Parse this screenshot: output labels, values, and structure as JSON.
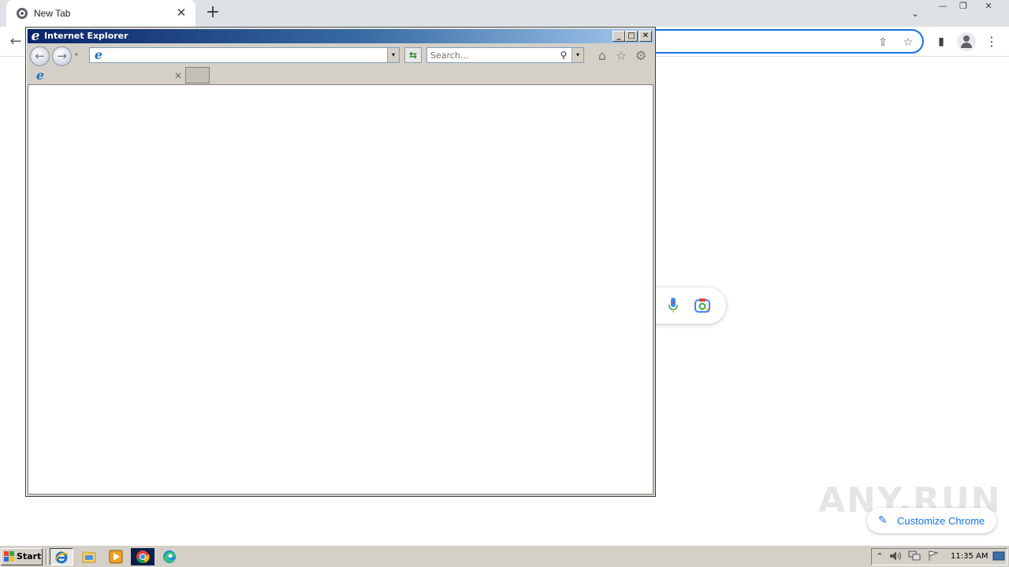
{
  "chrome": {
    "tab_title": "New Tab",
    "tab_close": "✕",
    "new_tab": "+",
    "tab_search": "⌄",
    "window_controls": {
      "minimize": "—",
      "restore": "❐",
      "close": "✕"
    },
    "back": "←",
    "share": "⇪",
    "bookmark": "☆",
    "side_panel": "▮"
  },
  "ntp": {
    "customize_label": "Customize Chrome",
    "customize_icon": "✎"
  },
  "watermark": "ANY.RUN",
  "ie": {
    "window_title": "Internet Explorer",
    "title_icon": "e",
    "caption": {
      "minimize": "_",
      "maximize": "□",
      "close": "✕"
    },
    "back": "←",
    "forward": "→",
    "nav_dropdown": "▾",
    "address_value": "",
    "address_dropdown": "▾",
    "refresh": "⇆",
    "search_placeholder": "Search...",
    "search_icon": "⚲",
    "search_dropdown": "▾",
    "home": "⌂",
    "favorites": "☆",
    "tools": "⚙",
    "tab_close": "×"
  },
  "taskbar": {
    "start_label": "Start",
    "tray_expand": "⌃",
    "clock": "11:35 AM"
  }
}
